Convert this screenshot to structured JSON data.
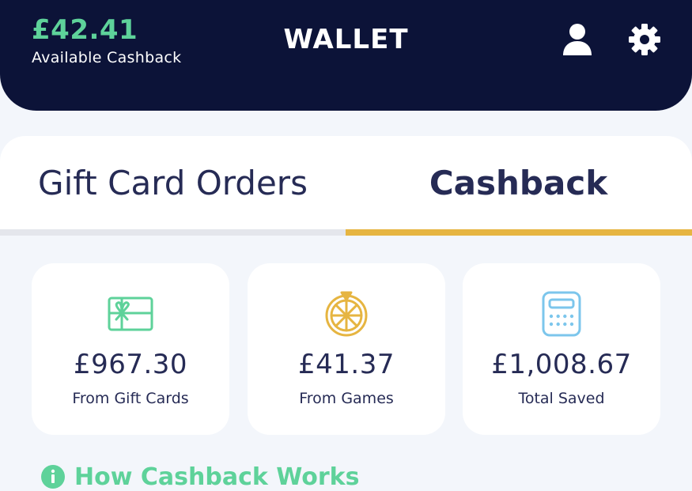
{
  "header": {
    "balance_amount": "£42.41",
    "balance_label": "Available Cashback",
    "title": "WALLET",
    "profile_icon": "profile-icon",
    "settings_icon": "gear-icon"
  },
  "tabs": [
    {
      "label": "Gift Card Orders",
      "active": false
    },
    {
      "label": "Cashback",
      "active": true
    }
  ],
  "stats": [
    {
      "icon": "gift-card-icon",
      "value": "£967.30",
      "label": "From Gift Cards",
      "color": "#5ed29a"
    },
    {
      "icon": "prize-wheel-icon",
      "value": "£41.37",
      "label": "From Games",
      "color": "#e6b541"
    },
    {
      "icon": "calculator-icon",
      "value": "£1,008.67",
      "label": "Total Saved",
      "color": "#7cc6ec"
    }
  ],
  "how_it_works": {
    "icon": "info-icon",
    "label": "How Cashback Works"
  },
  "colors": {
    "header_bg": "#0c1338",
    "accent_green": "#5ed29a",
    "accent_gold": "#e6b541",
    "text_dark": "#262b55",
    "page_bg": "#f3f6fb"
  }
}
